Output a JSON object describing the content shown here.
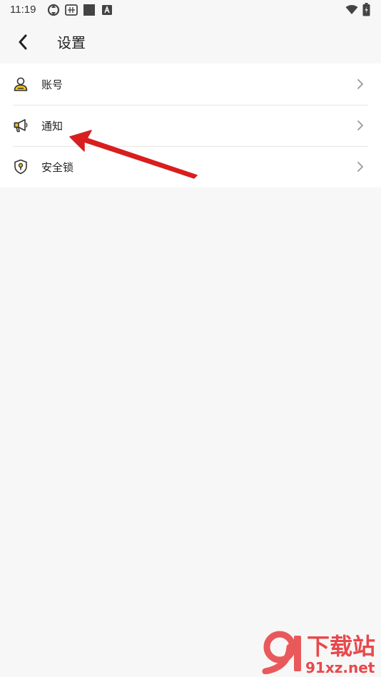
{
  "status_bar": {
    "time": "11:19",
    "icons": [
      "sync-icon",
      "keyboard-icon",
      "square-icon",
      "a-badge-icon",
      "wifi-icon",
      "battery-icon"
    ]
  },
  "header": {
    "title": "设置",
    "back_icon": "chevron-left-icon"
  },
  "menu": {
    "items": [
      {
        "label": "账号",
        "icon": "user-icon"
      },
      {
        "label": "通知",
        "icon": "megaphone-icon"
      },
      {
        "label": "安全锁",
        "icon": "shield-lock-icon"
      }
    ]
  },
  "colors": {
    "background": "#f7f7f7",
    "card": "#ffffff",
    "accent_yellow": "#f5c518",
    "arrow_red": "#d81e1e"
  },
  "watermark": {
    "big_text": "下载站",
    "domain": "91xz.net"
  }
}
